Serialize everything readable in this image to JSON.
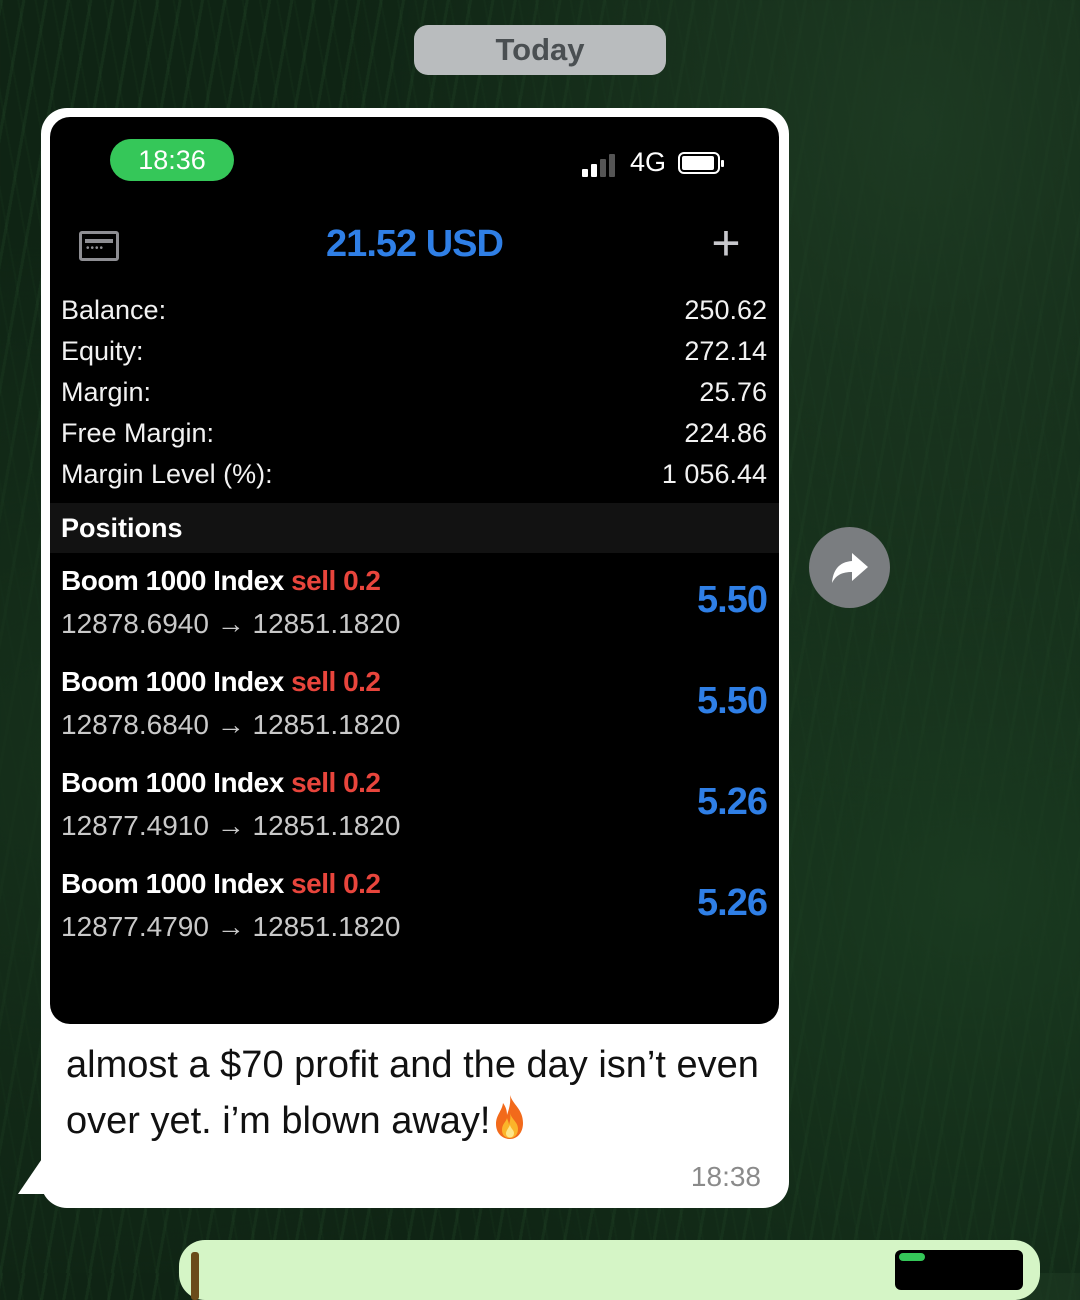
{
  "chat": {
    "date_label": "Today",
    "message": {
      "text": "almost a $70 profit and the day isn’t even over yet. i’m blown away!",
      "emoji": "fire-emoji",
      "time": "18:38"
    }
  },
  "screenshot": {
    "status_bar": {
      "time": "18:36",
      "network": "4G",
      "signal_bars_filled": 2,
      "signal_bars_total": 4
    },
    "header": {
      "value": "21.52 USD",
      "left_icon": "card-icon",
      "right_icon": "plus-icon"
    },
    "summary": [
      {
        "label": "Balance:",
        "value": "250.62"
      },
      {
        "label": "Equity:",
        "value": "272.14"
      },
      {
        "label": "Margin:",
        "value": "25.76"
      },
      {
        "label": "Free Margin:",
        "value": "224.86"
      },
      {
        "label": "Margin Level (%):",
        "value": "1 056.44"
      }
    ],
    "positions_title": "Positions",
    "positions": [
      {
        "symbol": "Boom 1000 Index",
        "side": "sell 0.2",
        "open": "12878.6940",
        "arrow": "→",
        "current": "12851.1820",
        "profit": "5.50"
      },
      {
        "symbol": "Boom 1000 Index",
        "side": "sell 0.2",
        "open": "12878.6840",
        "arrow": "→",
        "current": "12851.1820",
        "profit": "5.50"
      },
      {
        "symbol": "Boom 1000 Index",
        "side": "sell 0.2",
        "open": "12877.4910",
        "arrow": "→",
        "current": "12851.1820",
        "profit": "5.26"
      },
      {
        "symbol": "Boom 1000 Index",
        "side": "sell 0.2",
        "open": "12877.4790",
        "arrow": "→",
        "current": "12851.1820",
        "profit": "5.26"
      }
    ]
  },
  "colors": {
    "profit_blue": "#2f7fe6",
    "sell_red": "#e8453c",
    "status_green": "#35c759",
    "outgoing_bubble": "#d5f5c6"
  }
}
